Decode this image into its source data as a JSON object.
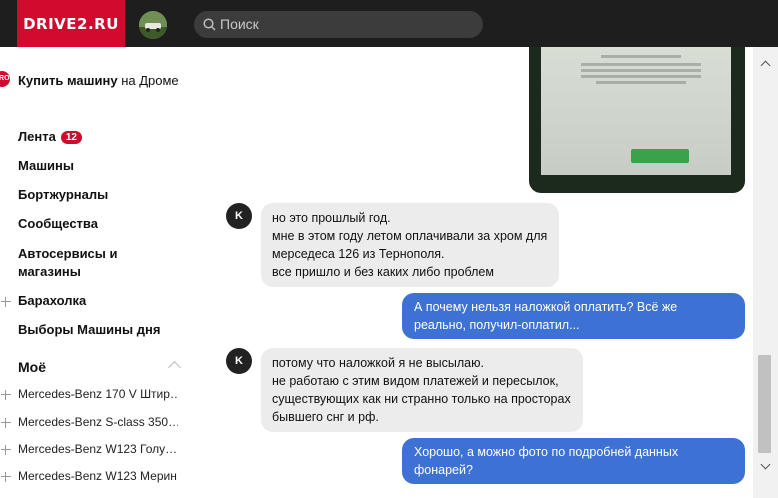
{
  "header": {
    "logo": "DRIVE2.RU",
    "search": {
      "placeholder": "Поиск"
    }
  },
  "sidebar": {
    "drom_badge": "DROM",
    "drom_bold": "Купить машину",
    "drom_rest": " на Дроме",
    "items": [
      {
        "label": "Лента",
        "badge": "12"
      },
      {
        "label": "Машины"
      },
      {
        "label": "Бортжурналы"
      },
      {
        "label": "Сообщества"
      },
      {
        "label": "Автосервисы и магазины"
      },
      {
        "label": "Барахолка"
      },
      {
        "label": "Выборы Машины дня"
      }
    ],
    "section_title": "Моё",
    "cars": [
      "Mercedes-Benz 170 V Штир…",
      "Mercedes-Benz S-class 350…",
      "Mercedes-Benz W123 Голу…",
      "Mercedes-Benz W123 Мерин"
    ]
  },
  "chat": {
    "messages": [
      {
        "from": "in",
        "avatar": "K",
        "lines": [
          "но это прошлый год.",
          "мне в этом году летом оплачивали за хром для",
          "мерседеса 126 из Тернополя.",
          "все пришло и без каких либо проблем"
        ]
      },
      {
        "from": "out",
        "lines": [
          "А почему нельзя наложкой оплатить? Всё же",
          "реально, получил-оплатил..."
        ]
      },
      {
        "from": "in",
        "avatar": "K",
        "lines": [
          "потому что наложкой я не высылаю.",
          "не работаю с этим видом платежей и пересылок,",
          "существующих как ни странно только на просторах",
          "бывшего снг и рф."
        ]
      },
      {
        "from": "out",
        "lines": [
          "Хорошо, а можно фото по подробней данных",
          "фонарей?"
        ]
      }
    ]
  },
  "colors": {
    "brand": "#d20a2e",
    "outgoing": "#3d72d4",
    "incoming": "#ececec"
  }
}
